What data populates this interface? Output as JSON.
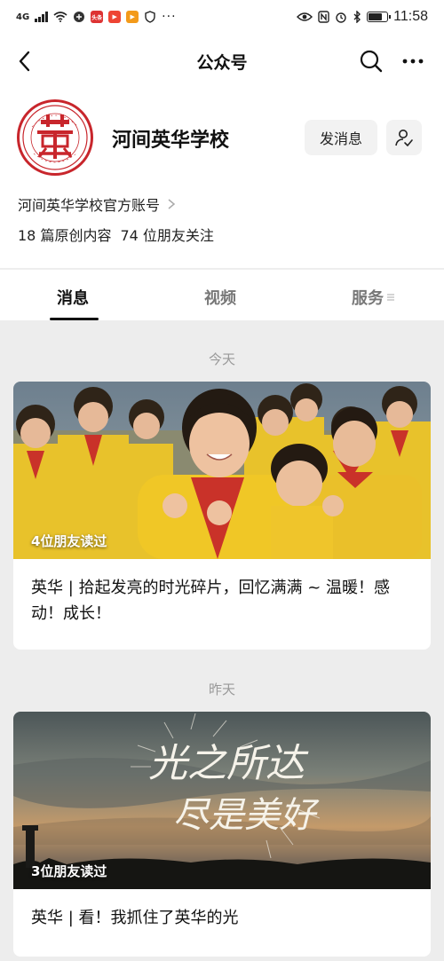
{
  "status_bar": {
    "network": "4G",
    "time": "11:58",
    "app_badges": [
      "头条",
      "▶",
      "▶"
    ],
    "battery_percent": 80
  },
  "nav": {
    "title": "公众号"
  },
  "profile": {
    "name": "河间英华学校",
    "description": "河间英华学校官方账号",
    "articles": "18 篇原创内容",
    "followers": "74 位朋友关注",
    "message_button": "发消息",
    "logo_text": "HE JIAN YING HUA XUE XIAO"
  },
  "tabs": [
    {
      "label": "消息",
      "active": true
    },
    {
      "label": "视频",
      "active": false
    },
    {
      "label": "服务",
      "active": false
    }
  ],
  "feed": [
    {
      "day": "今天",
      "read_by": "4位朋友读过",
      "title": "英华 | 拾起发亮的时光碎片，回忆满满 ~ 温暖！感动！成长！"
    },
    {
      "day": "昨天",
      "read_by": "3位朋友读过",
      "title": "英华 | 看！我抓住了英华的光",
      "image_text_1": "光之所达",
      "image_text_2": "尽是美好"
    }
  ]
}
